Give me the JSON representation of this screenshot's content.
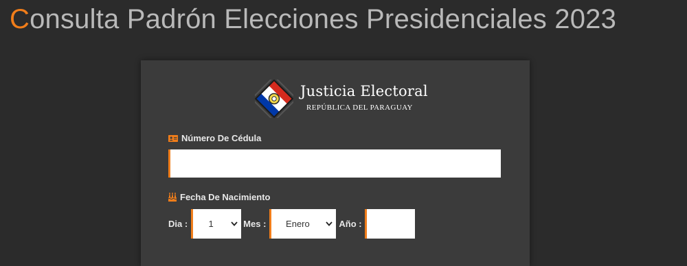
{
  "header": {
    "title_first_letter": "C",
    "title_rest": "onsulta Padrón Elecciones Presidenciales 2023"
  },
  "logo": {
    "name": "Justicia Electoral",
    "subtitle": "REPÚBLICA DEL PARAGUAY"
  },
  "form": {
    "cedula_label": "Número De Cédula",
    "cedula_value": "",
    "fecha_label": "Fecha De Nacimiento",
    "dia_label": "Dia :",
    "dia_value": "1",
    "mes_label": "Mes :",
    "mes_value": "Enero",
    "anio_label": "Año :",
    "anio_value": ""
  },
  "colors": {
    "accent": "#f07d1a",
    "background": "#2b2b2b",
    "card": "#3b3b3b"
  },
  "icons": {
    "cedula": "id-card-icon",
    "fecha": "birthday-cake-icon",
    "select_arrow": "chevron-down-icon"
  }
}
